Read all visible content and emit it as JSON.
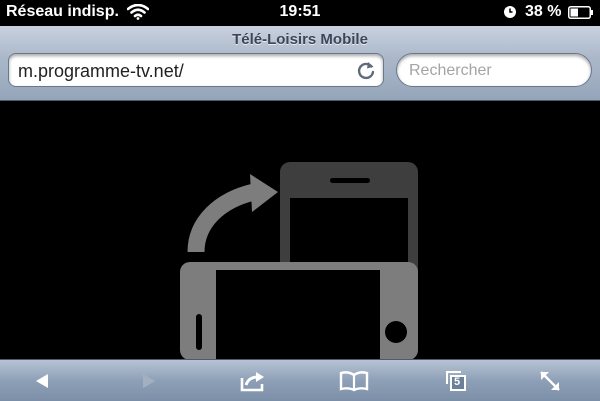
{
  "status_bar": {
    "carrier": "Réseau indisp.",
    "time": "19:51",
    "battery": "38 %",
    "icons": [
      "wifi-icon",
      "alarm-clock-icon",
      "battery-icon"
    ]
  },
  "browser": {
    "title": "Télé-Loisirs Mobile",
    "url": "m.programme-tv.net/",
    "search_placeholder": "Rechercher"
  },
  "toolbar": {
    "tabs_count": "5",
    "buttons": [
      "back",
      "forward",
      "share",
      "bookmarks",
      "tabs",
      "fullscreen"
    ],
    "forward_enabled": false
  },
  "content": {
    "illustration": "rotate-device-to-portrait"
  },
  "colors": {
    "bar_top": "#c8d1de",
    "bar_bottom": "#95a5b9",
    "toolbar_bottom": "#7c8fa8",
    "title_text": "#3c4658",
    "graphic_front": "#7d7d7d",
    "graphic_back": "#3e3e3e"
  }
}
